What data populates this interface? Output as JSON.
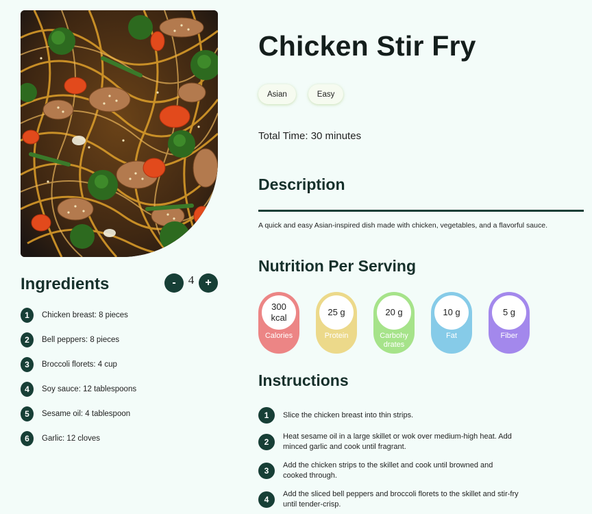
{
  "recipe": {
    "title": "Chicken Stir Fry",
    "tags": [
      "Asian",
      "Easy"
    ],
    "total_time": "Total Time: 30 minutes"
  },
  "ingredients": {
    "heading": "Ingredients",
    "servings": "4",
    "minus_label": "-",
    "plus_label": "+",
    "items": [
      {
        "n": "1",
        "text": "Chicken breast: 8 pieces"
      },
      {
        "n": "2",
        "text": "Bell peppers: 8 pieces"
      },
      {
        "n": "3",
        "text": "Broccoli florets: 4 cup"
      },
      {
        "n": "4",
        "text": "Soy sauce: 12 tablespoons"
      },
      {
        "n": "5",
        "text": "Sesame oil: 4 tablespoon"
      },
      {
        "n": "6",
        "text": "Garlic: 12 cloves"
      }
    ]
  },
  "description": {
    "heading": "Description",
    "text": "A quick and easy Asian-inspired dish made with chicken, vegetables, and a flavorful sauce."
  },
  "nutrition": {
    "heading": "Nutrition Per Serving",
    "items": [
      {
        "value": "300 kcal",
        "label": "Calories",
        "color": "#ec8585"
      },
      {
        "value": "25 g",
        "label": "Protein",
        "color": "#ecd98a"
      },
      {
        "value": "20 g",
        "label": "Carbohydrates",
        "color": "#a6e38a"
      },
      {
        "value": "10 g",
        "label": "Fat",
        "color": "#86cbe8"
      },
      {
        "value": "5 g",
        "label": "Fiber",
        "color": "#a388ec"
      }
    ]
  },
  "instructions": {
    "heading": "Instructions",
    "steps": [
      {
        "n": "1",
        "text": "Slice the chicken breast into thin strips."
      },
      {
        "n": "2",
        "text": "Heat sesame oil in a large skillet or wok over medium-high heat. Add minced garlic and cook until fragrant."
      },
      {
        "n": "3",
        "text": "Add the chicken strips to the skillet and cook until browned and cooked through."
      },
      {
        "n": "4",
        "text": "Add the sliced bell peppers and broccoli florets to the skillet and stir-fry until tender-crisp."
      }
    ]
  },
  "colors": {
    "accent": "#173f36",
    "background": "#f3fcf9"
  }
}
